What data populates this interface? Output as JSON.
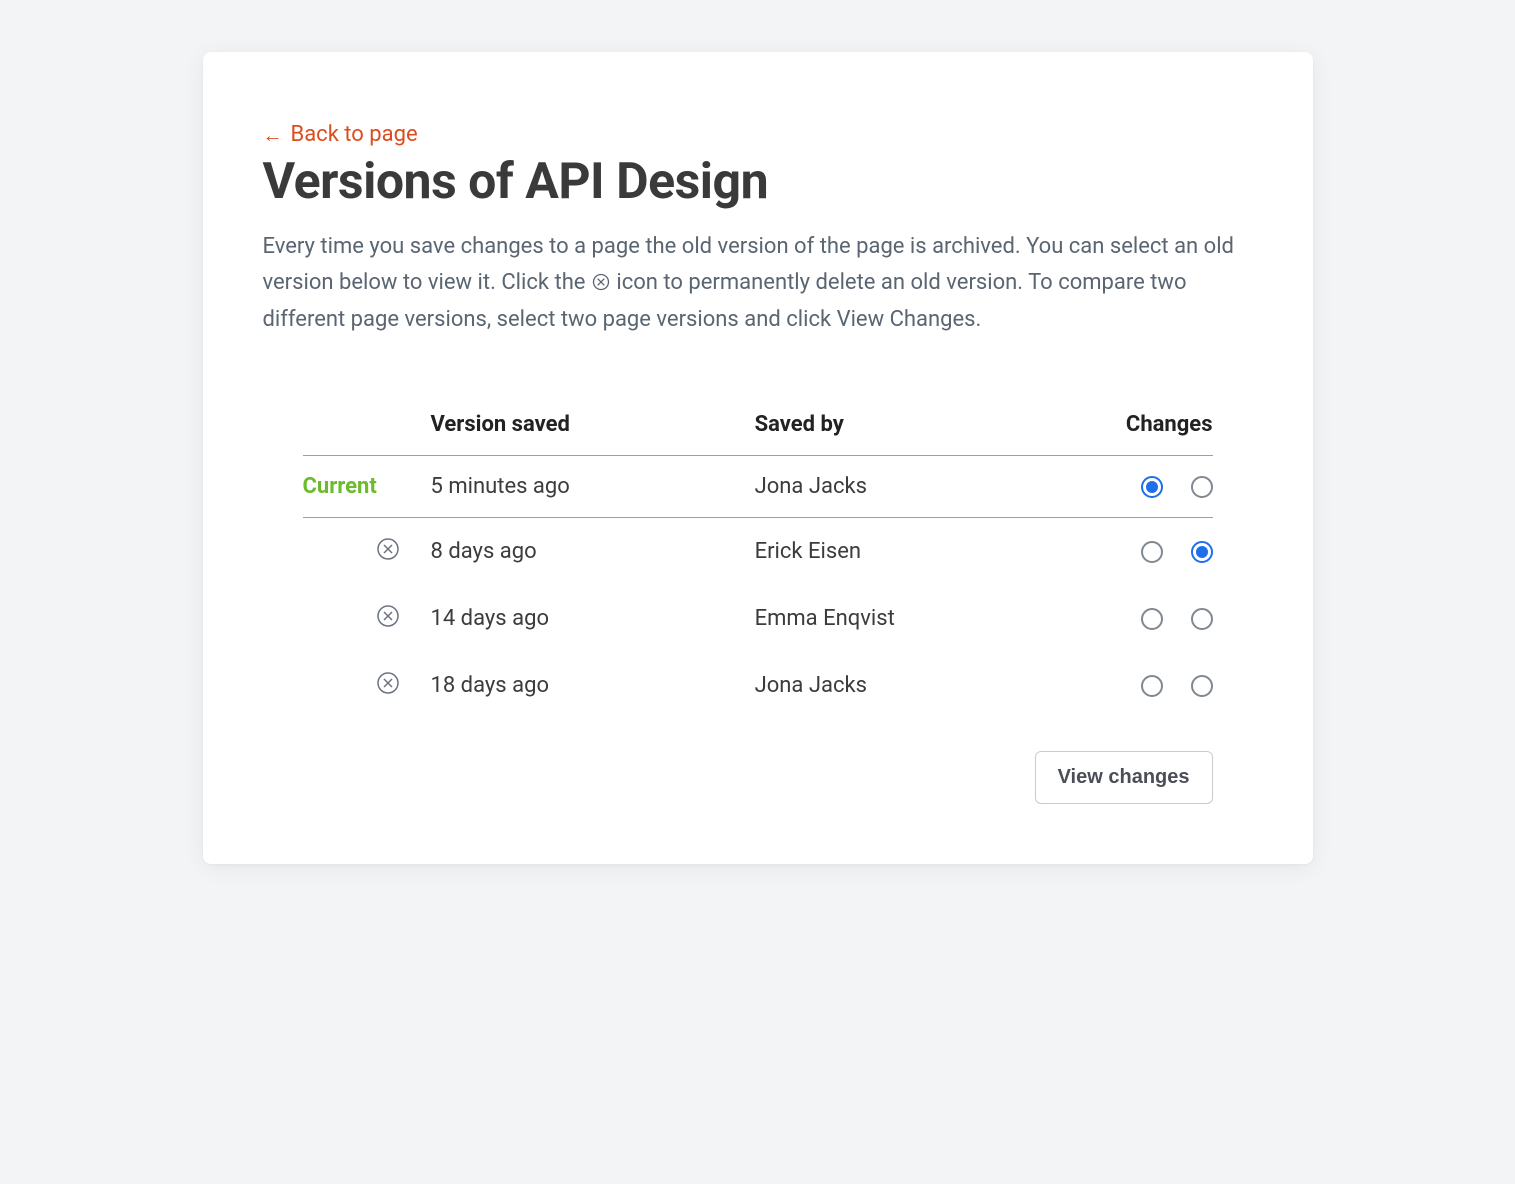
{
  "back_link": {
    "label": "Back to page"
  },
  "title": "Versions of API Design",
  "description": {
    "part1": "Every time you save changes to a page the old version of the page is archived. You can select an old version below to view it. Click the ",
    "part2": " icon to permanently delete an old version. To compare two different page versions, select two page versions and click View Changes."
  },
  "table": {
    "headers": {
      "version_saved": "Version saved",
      "saved_by": "Saved by",
      "changes": "Changes"
    },
    "current_label": "Current",
    "rows": [
      {
        "is_current": true,
        "saved": "5 minutes ago",
        "by": "Jona Jacks",
        "radio_a_checked": true,
        "radio_b_checked": false
      },
      {
        "is_current": false,
        "saved": "8 days ago",
        "by": "Erick Eisen",
        "radio_a_checked": false,
        "radio_b_checked": true
      },
      {
        "is_current": false,
        "saved": "14 days ago",
        "by": "Emma Enqvist",
        "radio_a_checked": false,
        "radio_b_checked": false
      },
      {
        "is_current": false,
        "saved": "18 days ago",
        "by": "Jona Jacks",
        "radio_a_checked": false,
        "radio_b_checked": false
      }
    ]
  },
  "view_changes_button": "View changes"
}
